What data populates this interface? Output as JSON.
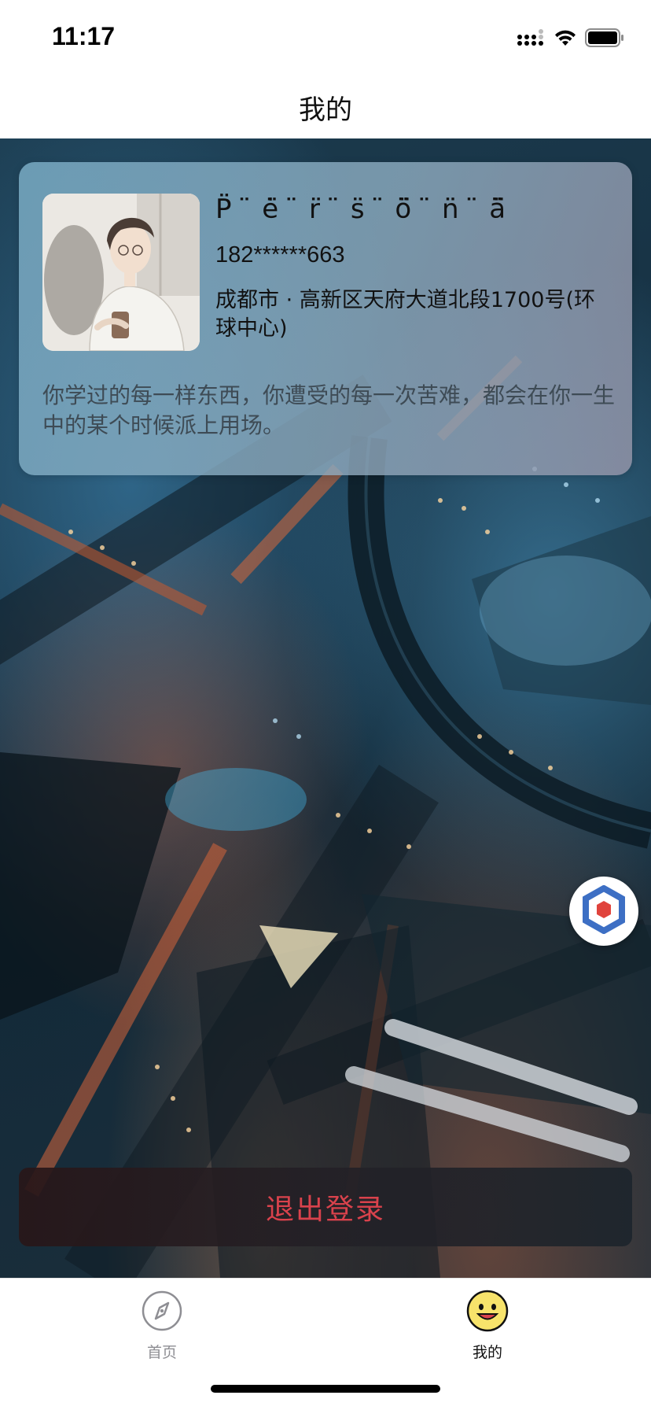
{
  "status_bar": {
    "time": "11:17"
  },
  "nav": {
    "title": "我的"
  },
  "profile": {
    "name": "P̈ ̈ė̈ ̈r̈ ̈s̈ ̈ö̈ ̈n̈ ̈ä̈",
    "phone": "182******663",
    "address": "成都市 · 高新区天府大道北段1700号(环球中心)",
    "quote": "你学过的每一样东西，你遭受的每一次苦难，都会在你一生中的某个时候派上用场。"
  },
  "actions": {
    "logout_label": "退出登录"
  },
  "tabs": [
    {
      "label": "首页",
      "icon": "compass-icon",
      "active": false
    },
    {
      "label": "我的",
      "icon": "smiley-face-icon",
      "active": true
    }
  ],
  "colors": {
    "logout_text": "#d9424c",
    "tab_active": "#111111",
    "tab_inactive": "#8e8e93",
    "smiley_fill": "#f7e36b",
    "widget_blue": "#3d6fc4",
    "widget_red": "#e0433c"
  }
}
